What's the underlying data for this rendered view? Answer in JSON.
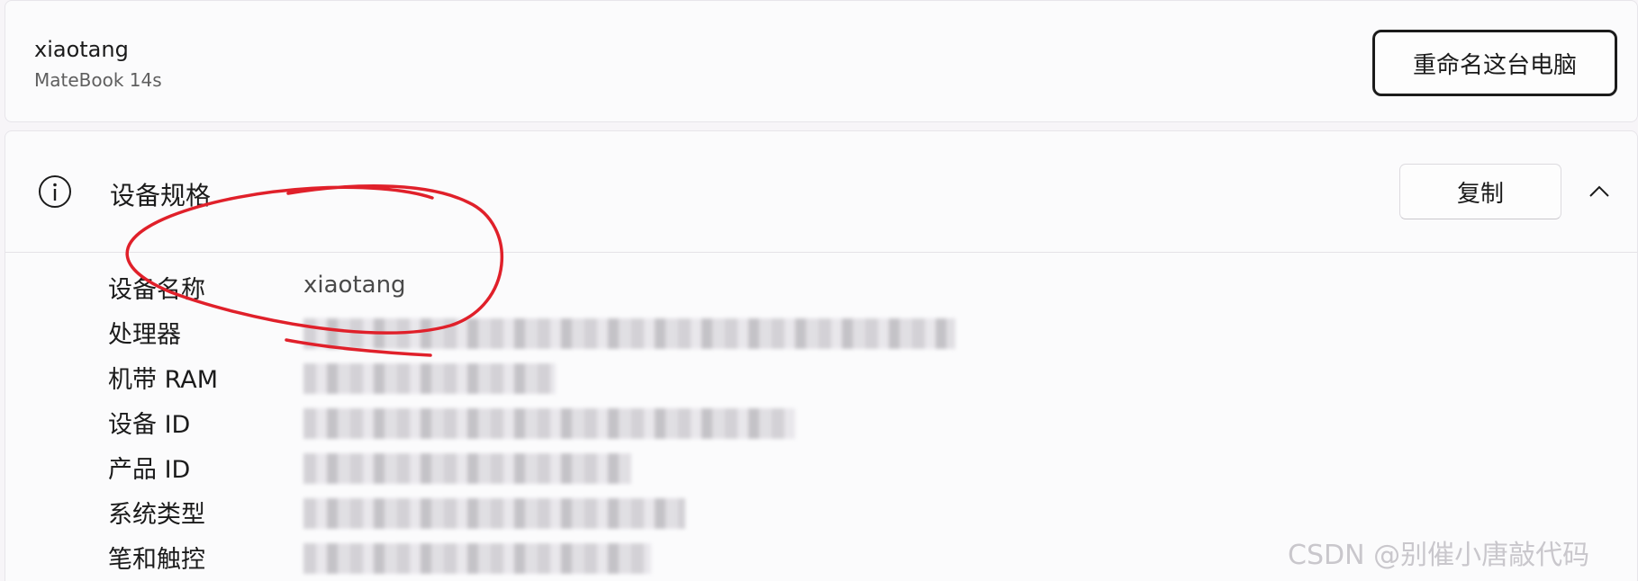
{
  "device": {
    "name": "xiaotang",
    "model": "MateBook 14s",
    "rename_label": "重命名这台电脑"
  },
  "specs": {
    "title": "设备规格",
    "copy_label": "复制",
    "rows": [
      {
        "label": "设备名称",
        "value": "xiaotang"
      },
      {
        "label": "处理器",
        "value": ""
      },
      {
        "label": "机带 RAM",
        "value": ""
      },
      {
        "label": "设备 ID",
        "value": ""
      },
      {
        "label": "产品 ID",
        "value": ""
      },
      {
        "label": "系统类型",
        "value": ""
      },
      {
        "label": "笔和触控",
        "value": ""
      }
    ]
  },
  "watermark": "CSDN @别催小唐敲代码",
  "colors": {
    "annotation_red": "#e0202a",
    "card_bg": "#fbfbfc",
    "border": "#e7e5ea"
  }
}
